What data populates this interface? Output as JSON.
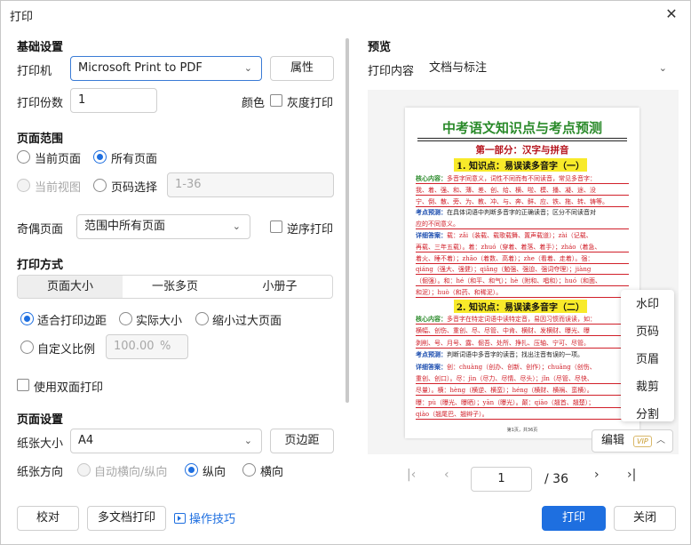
{
  "window": {
    "title": "打印",
    "close_glyph": "✕"
  },
  "basic": {
    "heading": "基础设置",
    "printer_label": "打印机",
    "printer_value": "Microsoft Print to PDF",
    "properties_btn": "属性",
    "copies_label": "打印份数",
    "copies_value": "1",
    "color_label": "颜色",
    "grayscale_label": "灰度打印"
  },
  "range": {
    "heading": "页面范围",
    "current_page": "当前页面",
    "all_pages": "所有页面",
    "current_view": "当前视图",
    "page_select": "页码选择",
    "page_select_placeholder": "1-36",
    "odd_even_label": "奇偶页面",
    "odd_even_value": "范围中所有页面",
    "reverse_label": "逆序打印"
  },
  "mode": {
    "heading": "打印方式",
    "tabs": [
      "页面大小",
      "一张多页",
      "小册子"
    ],
    "fit_margin": "适合打印边距",
    "actual_size": "实际大小",
    "shrink_large": "缩小过大页面",
    "custom_scale": "自定义比例",
    "scale_value": "100.00",
    "scale_unit": "%",
    "duplex_label": "使用双面打印"
  },
  "page_setup": {
    "heading": "页面设置",
    "paper_size_label": "纸张大小",
    "paper_size_value": "A4",
    "margins_btn": "页边距",
    "orientation_label": "纸张方向",
    "auto_orientation": "自动横向/纵向",
    "portrait": "纵向",
    "landscape": "横向"
  },
  "preview": {
    "heading": "预览",
    "content_label": "打印内容",
    "content_value": "文档与标注",
    "doc": {
      "title": "中考语文知识点与考点预测",
      "part1": "第一部分：汉字与拼音",
      "point1": "1. 知识点：易误读多音字（一）",
      "point2": "2. 知识点：易误读多音字（二）",
      "rows1": [
        {
          "k": "核心内容：",
          "t": "多音字同意义，词性不同而有不同读音，常见多音字："
        },
        {
          "k": "",
          "t": "我、着、强、和、薄、差、创、给、横、啦、模、播、凝、途、没"
        },
        {
          "k": "",
          "t": "宁、倒、散、旁、为、教、冲、与、奔、鲜、应、铁、拖、转、铸等。"
        },
        {
          "k": "考点预测：",
          "t": "在具体词语中判断多音字的正确读音；区分不同读音对"
        },
        {
          "k": "",
          "t": "应的不同意义。"
        },
        {
          "k": "详细答案：",
          "t": "载：zǎi（装载、载歌载舞、置声载道）；zài（记载、"
        },
        {
          "k": "",
          "t": "再载、三年五载）。着：zhuó（穿着、着落、着手）；zháo（着急、"
        },
        {
          "k": "",
          "t": "着火、睡不着）；zhāo（着数、高着）；zhe（看着、走着）。强："
        },
        {
          "k": "",
          "t": "qiáng（强大、强健）；qiǎng（勉强、强迫、强词夺理）；jiàng"
        },
        {
          "k": "",
          "t": "（倔强）。和：hé（和平、和气）；hè（附和、唱和）；huó（和面、"
        },
        {
          "k": "",
          "t": "和泥）；huò（和药、和稀泥）。"
        }
      ],
      "rows2": [
        {
          "k": "核心内容：",
          "t": "多音字在特定词语中读特定音，易因习惯而误读，如："
        },
        {
          "k": "",
          "t": "横幅、创伤、重创、尽、尽管、中肯、横财、发横财、曝光、曝"
        },
        {
          "k": "",
          "t": "剥削、号、月号、露、倔吾、处所、挣扎、压轴、宁可、尽管。"
        },
        {
          "k": "考点预测：",
          "t": "判断词语中多音字的读音；找出注音有误的一项。"
        },
        {
          "k": "详细答案：",
          "t": "创：chuàng（创办、创新、创作）；chuāng（创伤、"
        },
        {
          "k": "",
          "t": "重创、创口）。尽：jìn（尽力、尽情、尽头）；jǐn（尽管、尽快、"
        },
        {
          "k": "",
          "t": "尽量）。横：hèng（横逆、横蛮）；héng（横财、横祸、蛮横）。"
        },
        {
          "k": "",
          "t": "曝：pù（曝光、曝晒）；yān（曝光）。颠：qiāo（翘首、翘楚）；"
        },
        {
          "k": "",
          "t": "qiào（翘尾巴、翘辫子）。"
        }
      ],
      "footer": "第1页，共36页"
    },
    "menu": [
      "水印",
      "页码",
      "页眉",
      "裁剪",
      "分割"
    ],
    "edit_label": "编辑",
    "vip_badge": "VIP",
    "current_page": "1",
    "total_pages": "/ 36"
  },
  "footer": {
    "proofread": "校对",
    "multi_print": "多文档打印",
    "tips": "操作技巧",
    "print": "打印",
    "close": "关闭"
  },
  "colors": {
    "accent": "#1e6fe0",
    "doc_red": "#d1202a",
    "highlight": "#f8ea2a"
  }
}
